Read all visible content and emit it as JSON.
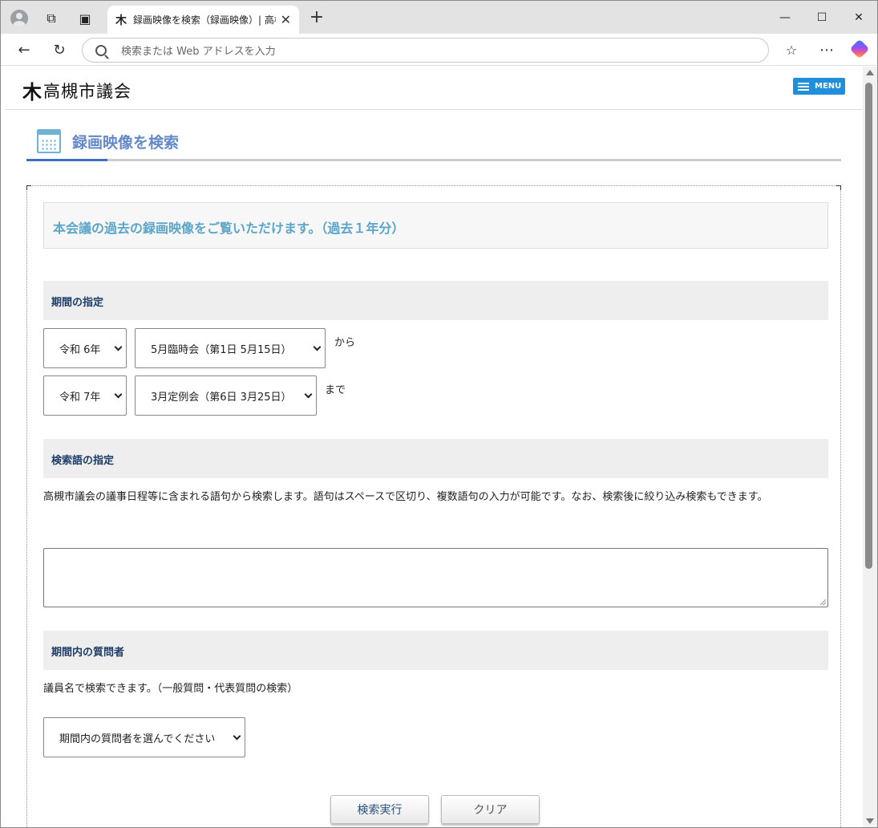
{
  "browser": {
    "tab_title": "録画映像を検索（録画映像）| 高槻市議会",
    "tab_favicon": "木",
    "address_placeholder": "検索または Web アドレスを入力"
  },
  "site": {
    "logo_mark": "木",
    "name": "高槻市議会",
    "menu_label": "MENU"
  },
  "page": {
    "title": "録画映像を検索",
    "intro": "本会議の過去の録画映像をご覧いただけます。（過去１年分）"
  },
  "period": {
    "heading": "期間の指定",
    "from_year": "令和 6年",
    "from_session": "5月臨時会（第1日 5月15日）",
    "from_suffix": "から",
    "to_year": "令和 7年",
    "to_session": "3月定例会（第6日 3月25日）",
    "to_suffix": "まで"
  },
  "keyword": {
    "heading": "検索語の指定",
    "description": "高槻市議会の議事日程等に含まれる語句から検索します。語句はスペースで区切り、複数語句の入力が可能です。なお、検索後に絞り込み検索もできます。",
    "value": ""
  },
  "questioner": {
    "heading": "期間内の質問者",
    "description": "議員名で検索できます。（一般質問・代表質問の検索）",
    "selected": "期間内の質問者を選んでください"
  },
  "buttons": {
    "search": "検索実行",
    "clear": "クリア"
  },
  "colors": {
    "accent": "#1f8fdc",
    "title": "#6489c9",
    "intro": "#5aa5c9",
    "section_heading": "#1d3d66"
  }
}
